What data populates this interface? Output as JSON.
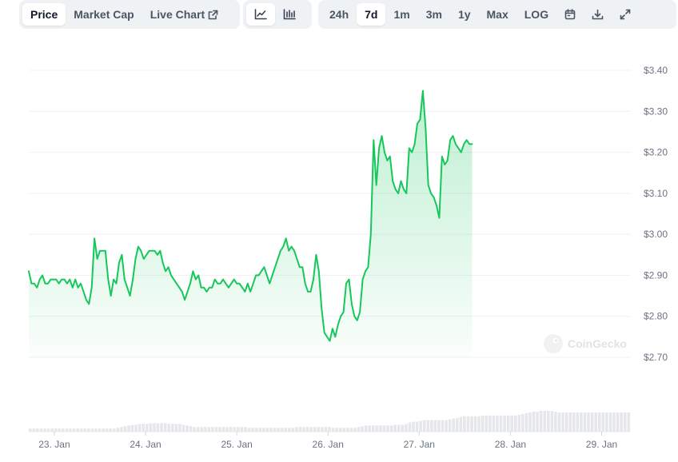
{
  "tabs": [
    {
      "label": "Price",
      "active": true
    },
    {
      "label": "Market Cap",
      "active": false
    },
    {
      "label": "Live Chart",
      "active": false
    }
  ],
  "chart_types": [
    "line-chart-icon",
    "candlestick-chart-icon"
  ],
  "ranges": [
    {
      "label": "24h",
      "active": false
    },
    {
      "label": "7d",
      "active": true
    },
    {
      "label": "1m",
      "active": false
    },
    {
      "label": "3m",
      "active": false
    },
    {
      "label": "1y",
      "active": false
    },
    {
      "label": "Max",
      "active": false
    },
    {
      "label": "LOG",
      "active": false
    }
  ],
  "tool_icons": [
    "calendar-icon",
    "download-icon",
    "expand-icon"
  ],
  "watermark": "CoinGecko",
  "colors": {
    "line": "#16c75b",
    "fill": "#16c75b",
    "volume": "#e5e7eb",
    "grid": "#eef0f3"
  },
  "chart_data": {
    "type": "line",
    "title": "",
    "xlabel": "",
    "ylabel": "",
    "ylim": [
      2.7,
      3.4
    ],
    "yticks": [
      "$3.40",
      "$3.30",
      "$3.20",
      "$3.10",
      "$3.00",
      "$2.90",
      "$2.80",
      "$2.70"
    ],
    "ytick_values": [
      3.4,
      3.3,
      3.2,
      3.1,
      3.0,
      2.9,
      2.8,
      2.7
    ],
    "xticks": [
      "23. Jan",
      "24. Jan",
      "25. Jan",
      "26. Jan",
      "27. Jan",
      "28. Jan",
      "29. Jan"
    ],
    "xtick_days": [
      1,
      2,
      3,
      4,
      5,
      6,
      7
    ],
    "xlim_days": [
      0.72,
      7.32
    ],
    "grid": true,
    "series": [
      {
        "points": [
          [
            0.72,
            2.91
          ],
          [
            0.75,
            2.88
          ],
          [
            0.78,
            2.88
          ],
          [
            0.81,
            2.87
          ],
          [
            0.84,
            2.89
          ],
          [
            0.87,
            2.9
          ],
          [
            0.9,
            2.88
          ],
          [
            0.93,
            2.88
          ],
          [
            0.96,
            2.89
          ],
          [
            0.99,
            2.89
          ],
          [
            1.02,
            2.89
          ],
          [
            1.05,
            2.88
          ],
          [
            1.08,
            2.89
          ],
          [
            1.11,
            2.89
          ],
          [
            1.14,
            2.88
          ],
          [
            1.17,
            2.89
          ],
          [
            1.2,
            2.87
          ],
          [
            1.23,
            2.89
          ],
          [
            1.26,
            2.87
          ],
          [
            1.29,
            2.88
          ],
          [
            1.32,
            2.86
          ],
          [
            1.35,
            2.84
          ],
          [
            1.38,
            2.83
          ],
          [
            1.41,
            2.87
          ],
          [
            1.44,
            2.99
          ],
          [
            1.47,
            2.94
          ],
          [
            1.5,
            2.96
          ],
          [
            1.53,
            2.96
          ],
          [
            1.56,
            2.96
          ],
          [
            1.59,
            2.89
          ],
          [
            1.62,
            2.85
          ],
          [
            1.65,
            2.89
          ],
          [
            1.68,
            2.88
          ],
          [
            1.71,
            2.93
          ],
          [
            1.74,
            2.95
          ],
          [
            1.77,
            2.89
          ],
          [
            1.8,
            2.87
          ],
          [
            1.83,
            2.85
          ],
          [
            1.86,
            2.89
          ],
          [
            1.89,
            2.94
          ],
          [
            1.92,
            2.97
          ],
          [
            1.95,
            2.96
          ],
          [
            1.98,
            2.94
          ],
          [
            2.01,
            2.95
          ],
          [
            2.04,
            2.96
          ],
          [
            2.07,
            2.96
          ],
          [
            2.1,
            2.96
          ],
          [
            2.13,
            2.95
          ],
          [
            2.16,
            2.96
          ],
          [
            2.19,
            2.93
          ],
          [
            2.22,
            2.91
          ],
          [
            2.25,
            2.92
          ],
          [
            2.28,
            2.9
          ],
          [
            2.31,
            2.89
          ],
          [
            2.34,
            2.88
          ],
          [
            2.37,
            2.87
          ],
          [
            2.4,
            2.86
          ],
          [
            2.43,
            2.84
          ],
          [
            2.46,
            2.86
          ],
          [
            2.49,
            2.88
          ],
          [
            2.52,
            2.91
          ],
          [
            2.55,
            2.89
          ],
          [
            2.58,
            2.9
          ],
          [
            2.61,
            2.87
          ],
          [
            2.64,
            2.87
          ],
          [
            2.67,
            2.86
          ],
          [
            2.7,
            2.87
          ],
          [
            2.73,
            2.87
          ],
          [
            2.76,
            2.89
          ],
          [
            2.79,
            2.88
          ],
          [
            2.82,
            2.88
          ],
          [
            2.85,
            2.89
          ],
          [
            2.88,
            2.88
          ],
          [
            2.91,
            2.87
          ],
          [
            2.94,
            2.88
          ],
          [
            2.97,
            2.89
          ],
          [
            3.0,
            2.88
          ],
          [
            3.03,
            2.88
          ],
          [
            3.06,
            2.87
          ],
          [
            3.09,
            2.86
          ],
          [
            3.12,
            2.88
          ],
          [
            3.15,
            2.86
          ],
          [
            3.18,
            2.88
          ],
          [
            3.21,
            2.9
          ],
          [
            3.24,
            2.9
          ],
          [
            3.27,
            2.91
          ],
          [
            3.3,
            2.92
          ],
          [
            3.33,
            2.9
          ],
          [
            3.36,
            2.88
          ],
          [
            3.39,
            2.9
          ],
          [
            3.42,
            2.92
          ],
          [
            3.45,
            2.94
          ],
          [
            3.48,
            2.96
          ],
          [
            3.51,
            2.97
          ],
          [
            3.54,
            2.99
          ],
          [
            3.57,
            2.96
          ],
          [
            3.6,
            2.97
          ],
          [
            3.63,
            2.96
          ],
          [
            3.66,
            2.94
          ],
          [
            3.69,
            2.92
          ],
          [
            3.72,
            2.92
          ],
          [
            3.75,
            2.88
          ],
          [
            3.78,
            2.86
          ],
          [
            3.81,
            2.86
          ],
          [
            3.84,
            2.89
          ],
          [
            3.87,
            2.95
          ],
          [
            3.9,
            2.91
          ],
          [
            3.93,
            2.82
          ],
          [
            3.96,
            2.76
          ],
          [
            3.99,
            2.75
          ],
          [
            4.02,
            2.74
          ],
          [
            4.05,
            2.77
          ],
          [
            4.08,
            2.75
          ],
          [
            4.11,
            2.78
          ],
          [
            4.14,
            2.8
          ],
          [
            4.17,
            2.81
          ],
          [
            4.2,
            2.88
          ],
          [
            4.23,
            2.89
          ],
          [
            4.26,
            2.83
          ],
          [
            4.29,
            2.8
          ],
          [
            4.32,
            2.79
          ],
          [
            4.35,
            2.81
          ],
          [
            4.38,
            2.89
          ],
          [
            4.41,
            2.91
          ],
          [
            4.44,
            2.92
          ],
          [
            4.47,
            3.0
          ],
          [
            4.5,
            3.23
          ],
          [
            4.53,
            3.12
          ],
          [
            4.56,
            3.21
          ],
          [
            4.59,
            3.24
          ],
          [
            4.62,
            3.2
          ],
          [
            4.65,
            3.18
          ],
          [
            4.68,
            3.19
          ],
          [
            4.71,
            3.13
          ],
          [
            4.74,
            3.11
          ],
          [
            4.77,
            3.1
          ],
          [
            4.8,
            3.13
          ],
          [
            4.83,
            3.11
          ],
          [
            4.86,
            3.1
          ],
          [
            4.89,
            3.21
          ],
          [
            4.92,
            3.2
          ],
          [
            4.95,
            3.22
          ],
          [
            4.98,
            3.27
          ],
          [
            5.01,
            3.28
          ],
          [
            5.04,
            3.35
          ],
          [
            5.07,
            3.26
          ],
          [
            5.1,
            3.12
          ],
          [
            5.13,
            3.1
          ],
          [
            5.16,
            3.09
          ],
          [
            5.19,
            3.07
          ],
          [
            5.22,
            3.04
          ],
          [
            5.25,
            3.19
          ],
          [
            5.28,
            3.17
          ],
          [
            5.31,
            3.18
          ],
          [
            5.34,
            3.23
          ],
          [
            5.37,
            3.24
          ],
          [
            5.4,
            3.22
          ],
          [
            5.43,
            3.21
          ],
          [
            5.46,
            3.2
          ],
          [
            5.49,
            3.22
          ],
          [
            5.52,
            3.23
          ],
          [
            5.55,
            3.22
          ],
          [
            5.58,
            3.22
          ]
        ]
      }
    ],
    "volume": {
      "note": "",
      "values": [
        0.08,
        0.08,
        0.08,
        0.08,
        0.08,
        0.08,
        0.08,
        0.08,
        0.08,
        0.08,
        0.08,
        0.08,
        0.08,
        0.08,
        0.08,
        0.08,
        0.08,
        0.08,
        0.08,
        0.08,
        0.08,
        0.08,
        0.08,
        0.08,
        0.1,
        0.12,
        0.14,
        0.16,
        0.17,
        0.18,
        0.2,
        0.2,
        0.2,
        0.22,
        0.22,
        0.22,
        0.22,
        0.22,
        0.2,
        0.2,
        0.2,
        0.2,
        0.18,
        0.16,
        0.14,
        0.12,
        0.12,
        0.12,
        0.12,
        0.12,
        0.12,
        0.12,
        0.12,
        0.12,
        0.12,
        0.12,
        0.12,
        0.12,
        0.12,
        0.12,
        0.1,
        0.1,
        0.1,
        0.1,
        0.1,
        0.1,
        0.1,
        0.1,
        0.1,
        0.1,
        0.1,
        0.1,
        0.1,
        0.12,
        0.12,
        0.12,
        0.12,
        0.12,
        0.12,
        0.12,
        0.12,
        0.12,
        0.12,
        0.1,
        0.1,
        0.1,
        0.1,
        0.1,
        0.1,
        0.1,
        0.12,
        0.14,
        0.16,
        0.16,
        0.16,
        0.16,
        0.16,
        0.16,
        0.16,
        0.16,
        0.18,
        0.18,
        0.18,
        0.2,
        0.24,
        0.26,
        0.26,
        0.28,
        0.3,
        0.3,
        0.3,
        0.3,
        0.3,
        0.3,
        0.3,
        0.32,
        0.34,
        0.36,
        0.38,
        0.4,
        0.4,
        0.4,
        0.4,
        0.4,
        0.42,
        0.42,
        0.42,
        0.42,
        0.42,
        0.42,
        0.42,
        0.42,
        0.42,
        0.42,
        0.44,
        0.46,
        0.48,
        0.5,
        0.52,
        0.52,
        0.54,
        0.54,
        0.54,
        0.54,
        0.52,
        0.5,
        0.5,
        0.5,
        0.5,
        0.5,
        0.5,
        0.5,
        0.5,
        0.5,
        0.5,
        0.5,
        0.5,
        0.5,
        0.5,
        0.5,
        0.5,
        0.5,
        0.5,
        0.5,
        0.5
      ]
    }
  }
}
